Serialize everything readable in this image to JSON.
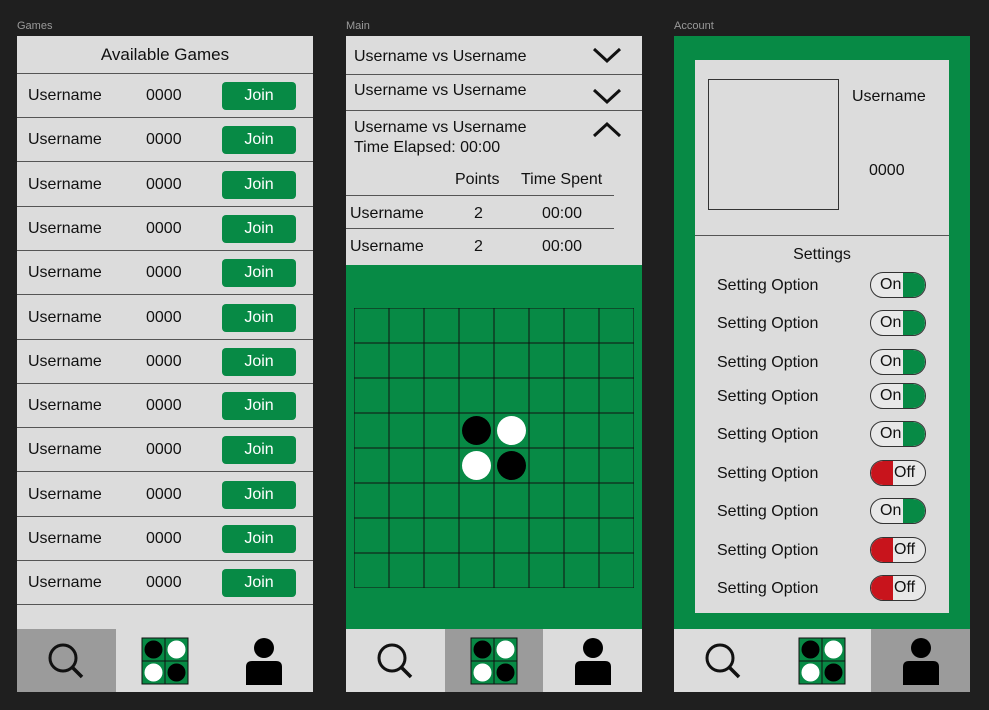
{
  "labels": {
    "games": "Games",
    "main": "Main",
    "account": "Account"
  },
  "colors": {
    "accent": "#078a45",
    "off_red": "#c8141c",
    "panel": "#dcdcdc",
    "background": "#1f1f1f"
  },
  "games": {
    "title": "Available Games",
    "join_label": "Join",
    "rows": [
      {
        "username": "Username",
        "score": "0000"
      },
      {
        "username": "Username",
        "score": "0000"
      },
      {
        "username": "Username",
        "score": "0000"
      },
      {
        "username": "Username",
        "score": "0000"
      },
      {
        "username": "Username",
        "score": "0000"
      },
      {
        "username": "Username",
        "score": "0000"
      },
      {
        "username": "Username",
        "score": "0000"
      },
      {
        "username": "Username",
        "score": "0000"
      },
      {
        "username": "Username",
        "score": "0000"
      },
      {
        "username": "Username",
        "score": "0000"
      },
      {
        "username": "Username",
        "score": "0000"
      },
      {
        "username": "Username",
        "score": "0000"
      }
    ]
  },
  "main": {
    "matches": [
      {
        "title": "Username vs Username",
        "icon": "chevron-down-icon"
      },
      {
        "title": "Username vs Username",
        "icon": "chevron-down-icon"
      },
      {
        "title": "Username vs Username",
        "subtitle": "Time Elapsed: 00:00",
        "icon": "chevron-up-icon"
      }
    ],
    "stats_headers": {
      "points": "Points",
      "time": "Time Spent"
    },
    "stats_rows": [
      {
        "username": "Username",
        "points": "2",
        "time": "00:00"
      },
      {
        "username": "Username",
        "points": "2",
        "time": "00:00"
      }
    ],
    "board": {
      "size": 8,
      "pieces": [
        {
          "row": 3,
          "col": 3,
          "color": "black"
        },
        {
          "row": 3,
          "col": 4,
          "color": "white"
        },
        {
          "row": 4,
          "col": 3,
          "color": "white"
        },
        {
          "row": 4,
          "col": 4,
          "color": "black"
        }
      ]
    }
  },
  "account": {
    "username": "Username",
    "score": "0000",
    "settings_title": "Settings",
    "settings": [
      {
        "label": "Setting Option",
        "state": "On"
      },
      {
        "label": "Setting Option",
        "state": "On"
      },
      {
        "label": "Setting Option",
        "state": "On"
      },
      {
        "label": "Setting Option",
        "state": "On"
      },
      {
        "label": "Setting Option",
        "state": "On"
      },
      {
        "label": "Setting Option",
        "state": "Off"
      },
      {
        "label": "Setting Option",
        "state": "On"
      },
      {
        "label": "Setting Option",
        "state": "Off"
      },
      {
        "label": "Setting Option",
        "state": "Off"
      }
    ]
  },
  "nav": {
    "items": [
      {
        "icon": "search-icon"
      },
      {
        "icon": "game-board-icon"
      },
      {
        "icon": "user-icon"
      }
    ],
    "active": {
      "games": 0,
      "main": 1,
      "account": 2
    }
  }
}
